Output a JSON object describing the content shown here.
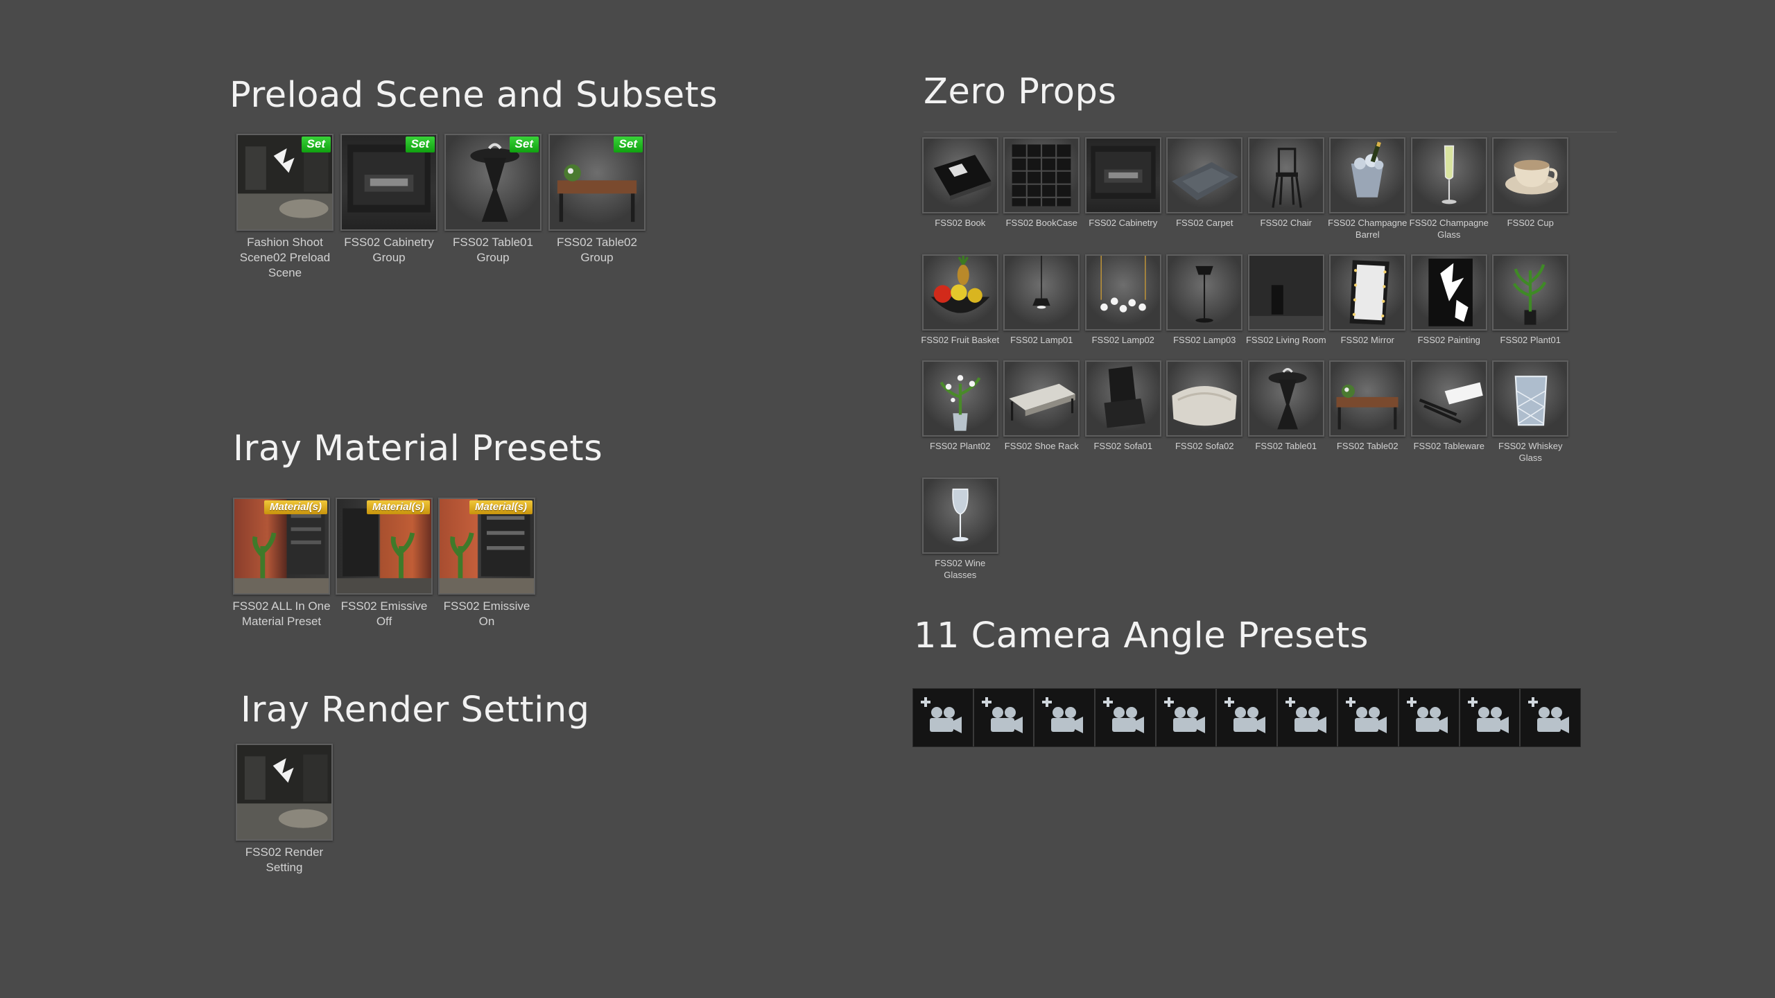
{
  "sections": {
    "preload": {
      "title": "Preload Scene and Subsets",
      "items": [
        {
          "label": "Fashion Shoot Scene02 Preload Scene",
          "badge": "Set",
          "icon": "room-scene-icon"
        },
        {
          "label": "FSS02 Cabinetry Group",
          "badge": "Set",
          "icon": "cabinetry-icon"
        },
        {
          "label": "FSS02 Table01 Group",
          "badge": "Set",
          "icon": "table01-icon"
        },
        {
          "label": "FSS02 Table02 Group",
          "badge": "Set",
          "icon": "table02-icon"
        }
      ]
    },
    "iray_material": {
      "title": "Iray Material Presets",
      "items": [
        {
          "label": "FSS02 ALL In One Material Preset",
          "badge": "Material(s)",
          "icon": "material-preset-icon"
        },
        {
          "label": "FSS02 Emissive Off",
          "badge": "Material(s)",
          "icon": "emissive-off-icon"
        },
        {
          "label": "FSS02 Emissive On",
          "badge": "Material(s)",
          "icon": "emissive-on-icon"
        }
      ]
    },
    "iray_render": {
      "title": "Iray Render Setting",
      "items": [
        {
          "label": "FSS02 Render Setting",
          "icon": "render-setting-icon"
        }
      ]
    },
    "zero_props": {
      "title": "Zero Props",
      "items": [
        {
          "label": "FSS02 Book",
          "icon": "book-icon"
        },
        {
          "label": "FSS02 BookCase",
          "icon": "bookcase-icon"
        },
        {
          "label": "FSS02 Cabinetry",
          "icon": "cabinetry-icon"
        },
        {
          "label": "FSS02 Carpet",
          "icon": "carpet-icon"
        },
        {
          "label": "FSS02 Chair",
          "icon": "chair-icon"
        },
        {
          "label": "FSS02 Champagne Barrel",
          "icon": "champagne-barrel-icon"
        },
        {
          "label": "FSS02 Champagne Glass",
          "icon": "champagne-glass-icon"
        },
        {
          "label": "FSS02 Cup",
          "icon": "cup-icon"
        },
        {
          "label": "FSS02 Fruit Basket",
          "icon": "fruit-basket-icon"
        },
        {
          "label": "FSS02 Lamp01",
          "icon": "lamp01-icon"
        },
        {
          "label": "FSS02 Lamp02",
          "icon": "lamp02-icon"
        },
        {
          "label": "FSS02 Lamp03",
          "icon": "lamp03-icon"
        },
        {
          "label": "FSS02 Living Room",
          "icon": "living-room-icon"
        },
        {
          "label": "FSS02 Mirror",
          "icon": "mirror-icon"
        },
        {
          "label": "FSS02 Painting",
          "icon": "painting-icon"
        },
        {
          "label": "FSS02 Plant01",
          "icon": "plant01-icon"
        },
        {
          "label": "FSS02 Plant02",
          "icon": "plant02-icon"
        },
        {
          "label": "FSS02 Shoe Rack",
          "icon": "shoe-rack-icon"
        },
        {
          "label": "FSS02 Sofa01",
          "icon": "sofa01-icon"
        },
        {
          "label": "FSS02 Sofa02",
          "icon": "sofa02-icon"
        },
        {
          "label": "FSS02 Table01",
          "icon": "table01-icon"
        },
        {
          "label": "FSS02 Table02",
          "icon": "table02-icon"
        },
        {
          "label": "FSS02 Tableware",
          "icon": "tableware-icon"
        },
        {
          "label": "FSS02 Whiskey Glass",
          "icon": "whiskey-glass-icon"
        },
        {
          "label": "FSS02 Wine Glasses",
          "icon": "wine-glasses-icon"
        }
      ]
    },
    "camera": {
      "title": "11 Camera Angle Presets",
      "count": 11,
      "icon": "add-camera-icon"
    }
  },
  "colors": {
    "background": "#4a4a4a",
    "set_badge": "#1fb51f",
    "material_badge": "#e0ae1f"
  }
}
